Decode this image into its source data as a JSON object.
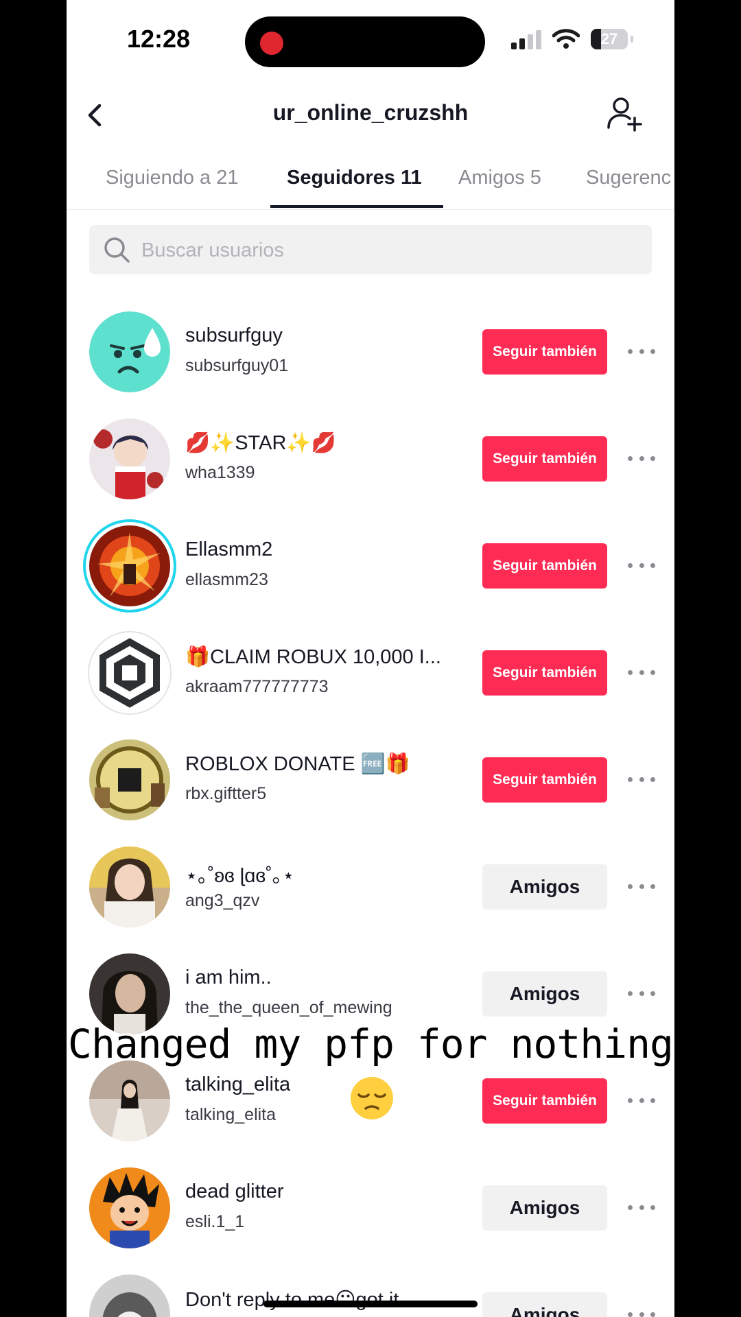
{
  "status_bar": {
    "time": "12:28",
    "battery": "27",
    "battery_level_pct": 27
  },
  "header": {
    "title": "ur_online_cruzshh"
  },
  "tabs": [
    {
      "label": "Siguiendo a 21"
    },
    {
      "label": "Seguidores 11"
    },
    {
      "label": "Amigos 5"
    },
    {
      "label": "Sugerenc"
    }
  ],
  "active_tab": "Seguidores 11",
  "search": {
    "placeholder": "Buscar usuarios",
    "value": ""
  },
  "followers": [
    {
      "name": "subsurfguy",
      "handle": "subsurfguy01",
      "button": "Seguir también"
    },
    {
      "name": "💋✨STAR✨💋",
      "handle": "wha1339",
      "button": "Seguir también"
    },
    {
      "name": "Ellasmm2",
      "handle": "ellasmm23",
      "button": "Seguir también"
    },
    {
      "name": "🎁CLAIM ROBUX 10,000 I...",
      "handle": "akraam777777773",
      "button": "Seguir también"
    },
    {
      "name": "ROBLOX DONATE 🆓🎁",
      "handle": "rbx.giftter5",
      "button": "Seguir también"
    },
    {
      "name": "⋆｡˚ʚɞ ɭɑɞ˚｡⋆",
      "handle": "ang3_qzv",
      "button": "Amigos"
    },
    {
      "name": "i am him..",
      "handle": "the_the_queen_of_mewing",
      "button": "Amigos"
    },
    {
      "name": "talking_elita",
      "handle": "talking_elita",
      "button": "Seguir también"
    },
    {
      "name": "dead glitter",
      "handle": "esli.1_1",
      "button": "Amigos"
    },
    {
      "name": "Don't reply to me😶got it...",
      "handle": "",
      "button": "Amigos"
    }
  ],
  "overlay": {
    "caption": "Changed my pfp for nothing"
  },
  "colors": {
    "follow_button": "#fe2c55",
    "friends_button": "#f1f1f2",
    "story_ring": "#20d5ec"
  }
}
